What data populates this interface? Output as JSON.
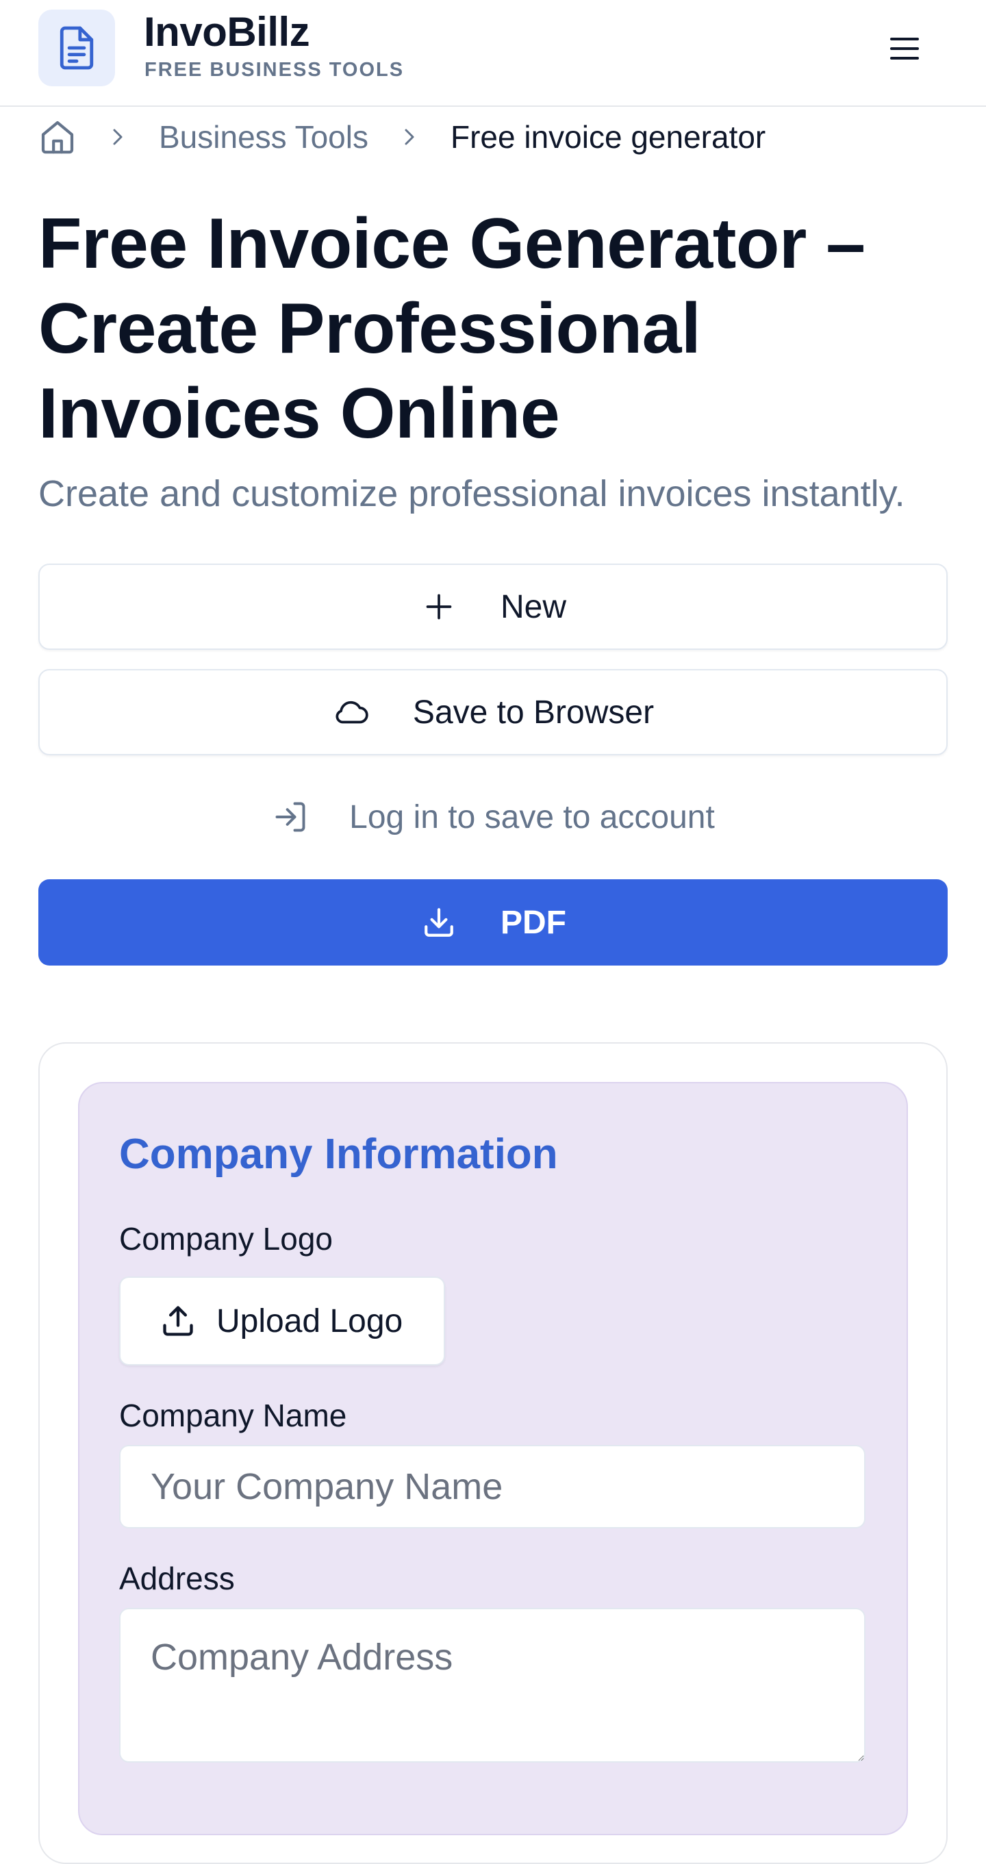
{
  "header": {
    "brand_name": "InvoBillz",
    "brand_tagline": "FREE BUSINESS TOOLS",
    "logo_icon": "document-icon",
    "menu_icon": "hamburger-menu-icon"
  },
  "breadcrumb": {
    "home_icon": "home-icon",
    "items": [
      {
        "label": "Business Tools"
      },
      {
        "label": "Free invoice generator"
      }
    ]
  },
  "page": {
    "title": "Free Invoice Generator – Create Professional Invoices Online",
    "subtitle": "Create and customize professional invoices instantly."
  },
  "actions": {
    "new_label": "New",
    "save_browser_label": "Save to Browser",
    "login_label": "Log in to save to account",
    "pdf_label": "PDF"
  },
  "company_section": {
    "title": "Company Information",
    "logo_label": "Company Logo",
    "upload_label": "Upload Logo",
    "name_label": "Company Name",
    "name_placeholder": "Your Company Name",
    "name_value": "",
    "address_label": "Address",
    "address_placeholder": "Company Address",
    "address_value": ""
  },
  "colors": {
    "accent": "#3563e0",
    "section_bg": "#ebe5f5",
    "section_title": "#3563d0",
    "muted_text": "#64748b"
  }
}
